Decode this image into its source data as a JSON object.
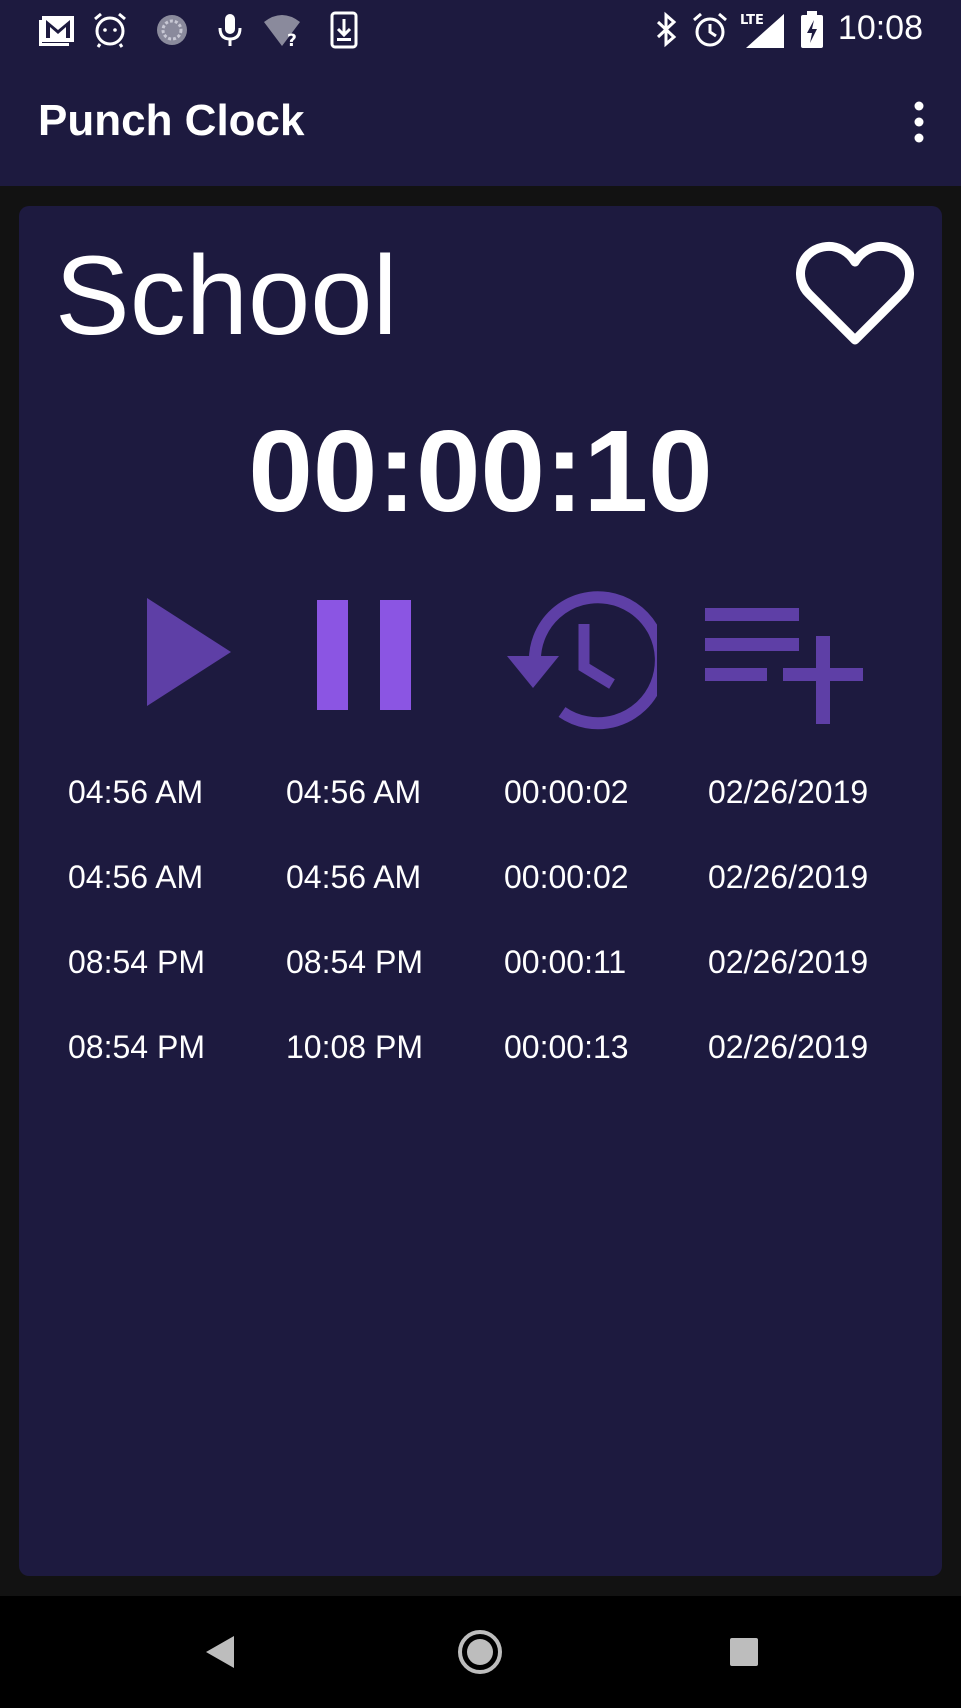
{
  "status_bar": {
    "time": "10:08",
    "icons": [
      "gmail-icon",
      "alarm-clock-icon",
      "sync-icon",
      "microphone-icon",
      "wifi-question-icon",
      "download-icon",
      "bluetooth-icon",
      "alarm-icon",
      "lte-signal-icon",
      "battery-charging-icon"
    ],
    "lte_label": "LTE"
  },
  "app_bar": {
    "title": "Punch Clock",
    "menu_icon": "more-vert-icon"
  },
  "card": {
    "title": "School",
    "favorite_icon": "heart-outline-icon",
    "timer": "00:00:10",
    "controls": {
      "play_icon": "play-icon",
      "pause_icon": "pause-icon",
      "history_icon": "history-icon",
      "playlist_add_icon": "playlist-add-icon"
    },
    "log": [
      {
        "start": "04:56 AM",
        "end": "04:56 AM",
        "duration": "00:00:02",
        "date": "02/26/2019"
      },
      {
        "start": "04:56 AM",
        "end": "04:56 AM",
        "duration": "00:00:02",
        "date": "02/26/2019"
      },
      {
        "start": "08:54 PM",
        "end": "08:54 PM",
        "duration": "00:00:11",
        "date": "02/26/2019"
      },
      {
        "start": "08:54 PM",
        "end": "10:08 PM",
        "duration": "00:00:13",
        "date": "02/26/2019"
      }
    ]
  },
  "nav_bar": {
    "back_icon": "back-triangle-icon",
    "home_icon": "home-circle-icon",
    "recents_icon": "recents-square-icon"
  },
  "colors": {
    "background": "#121212",
    "surface": "#1d1a3f",
    "accent_dark": "#5e3fa6",
    "accent_bright": "#8b55e3",
    "text": "#ffffff"
  }
}
